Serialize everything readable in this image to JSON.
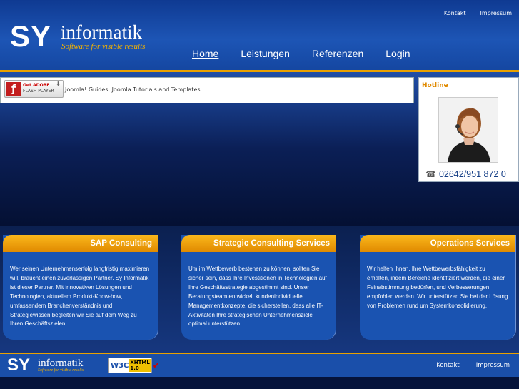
{
  "logo": {
    "main": "SY",
    "word": "informatik",
    "tagline": "Software for visible results"
  },
  "top_links": [
    "Kontakt",
    "Impressum"
  ],
  "nav": [
    {
      "label": "Home",
      "active": true
    },
    {
      "label": "Leistungen"
    },
    {
      "label": "Referenzen"
    },
    {
      "label": "Login"
    }
  ],
  "flash": {
    "button_line1": "Get ADOBE",
    "button_line2": "FLASH PLAYER",
    "caption": "Joomla! Guides, Joomla Tutorials and Templates"
  },
  "hotline": {
    "title": "Hotline",
    "phone": "02642/951 872 0",
    "phone_icon": "phone-icon"
  },
  "cards": [
    {
      "title": "SAP Consulting",
      "text": "Wer seinen Unternehmenserfolg langfristig maximieren will, braucht einen zuverlässigen Partner. Sy Informatik ist dieser Partner. Mit innovativen Lösungen und Technologien, aktuellem Produkt-Know-how, umfassendem Branchenverständnis und Strategiewissen begleiten wir Sie auf dem Weg zu Ihren Geschäftszielen."
    },
    {
      "title": "Strategic Consulting Services",
      "text": "Um im Wettbewerb bestehen zu können, sollten Sie sicher sein, dass Ihre Investitionen in Technologien auf Ihre Geschäftsstrategie abgestimmt sind. Unser Beratungsteam entwickelt kundenindividuelle Managementkonzepte, die sicherstellen, dass alle IT-Aktivitäten Ihre strategischen Unternehmensziele optimal unterstützen."
    },
    {
      "title": "Operations Services",
      "text": "Wir helfen Ihnen, Ihre Wettbewerbsfähigkeit zu erhalten, indem Bereiche identifiziert werden, die einer Feinabstimmung bedürfen, und Verbesserungen empfohlen werden. Wir unterstützen Sie bei der Lösung von Problemen rund um Systemkonsolidierung."
    }
  ],
  "footer": {
    "logo_main": "SY",
    "logo_word": "informatik",
    "logo_tagline": "Software for visible results",
    "badge_w3c": "W3C",
    "badge_line1": "XHTML",
    "badge_line2": "1.0",
    "links": [
      "Kontakt",
      "Impressum"
    ]
  },
  "colors": {
    "accent": "#e9a100",
    "header_blue": "#1d55b5",
    "card_blue": "#1a53b1",
    "dark_navy": "#05133b"
  }
}
